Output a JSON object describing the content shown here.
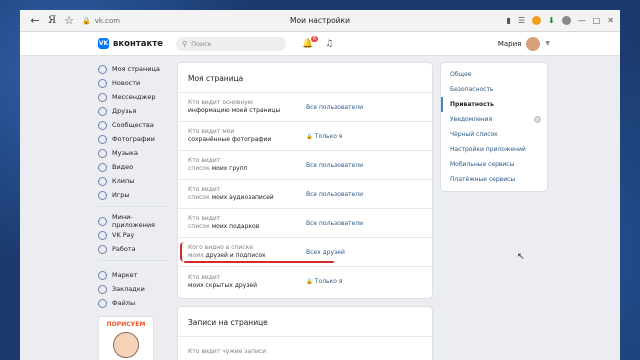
{
  "browser": {
    "url": "vk.com",
    "tab_title": "Мои настройки",
    "yandex_label": "Я"
  },
  "header": {
    "logo_text": "вконтакте",
    "search_placeholder": "Поиск",
    "notifications_badge": "6",
    "user_name": "Мария"
  },
  "left_nav": {
    "main": [
      {
        "label": "Моя страница"
      },
      {
        "label": "Новости"
      },
      {
        "label": "Мессенджер"
      },
      {
        "label": "Друзья"
      },
      {
        "label": "Сообщества"
      },
      {
        "label": "Фотографии"
      },
      {
        "label": "Музыка"
      },
      {
        "label": "Видео"
      },
      {
        "label": "Клипы"
      },
      {
        "label": "Игры"
      }
    ],
    "services": [
      {
        "label": "Мини-приложения"
      },
      {
        "label": "VK Pay"
      },
      {
        "label": "Работа"
      }
    ],
    "extra": [
      {
        "label": "Маркет"
      },
      {
        "label": "Закладки"
      },
      {
        "label": "Файлы"
      }
    ],
    "promo_title": "ПОРИСУЕМ"
  },
  "privacy": {
    "section_title": "Моя страница",
    "rows": [
      {
        "label_gray": "Кто видит основную",
        "label_dark": "информацию моей страницы",
        "label_prefix": "",
        "value": "Все пользователи",
        "lock": false
      },
      {
        "label_gray": "Кто видит мои",
        "label_dark": "сохранённые фотографии",
        "label_prefix": "",
        "value": "Только я",
        "lock": true
      },
      {
        "label_gray": "Кто видит",
        "label_dark": "моих групп",
        "label_prefix": "список ",
        "value": "Все пользователи",
        "lock": false
      },
      {
        "label_gray": "Кто видит",
        "label_dark": "моих аудиозаписей",
        "label_prefix": "список ",
        "value": "Все пользователи",
        "lock": false
      },
      {
        "label_gray": "Кто видит",
        "label_dark": "моих подарков",
        "label_prefix": "список ",
        "value": "Все пользователи",
        "lock": false
      },
      {
        "label_gray": "Кого видно в списке",
        "label_dark": "друзей и подписок",
        "label_prefix": "моих ",
        "value": "Всех друзей",
        "lock": false
      },
      {
        "label_gray": "Кто видит",
        "label_dark": "моих скрытых друзей",
        "label_prefix": "",
        "value": "Только я",
        "lock": true
      }
    ],
    "section2_title": "Записи на странице",
    "section2_first_row": "Кто видит чужие записи"
  },
  "settings_menu": [
    {
      "label": "Общее",
      "active": false
    },
    {
      "label": "Безопасность",
      "active": false
    },
    {
      "label": "Приватность",
      "active": true
    },
    {
      "label": "Уведомления",
      "active": false,
      "has_badge": true
    },
    {
      "label": "Чёрный список",
      "active": false
    },
    {
      "label": "Настройки приложений",
      "active": false
    },
    {
      "label": "Мобильные сервисы",
      "active": false
    },
    {
      "label": "Платёжные сервисы",
      "active": false
    }
  ],
  "colors": {
    "vk_blue": "#0077ff",
    "link": "#2a5885",
    "annotation_red": "#d42b2b"
  }
}
